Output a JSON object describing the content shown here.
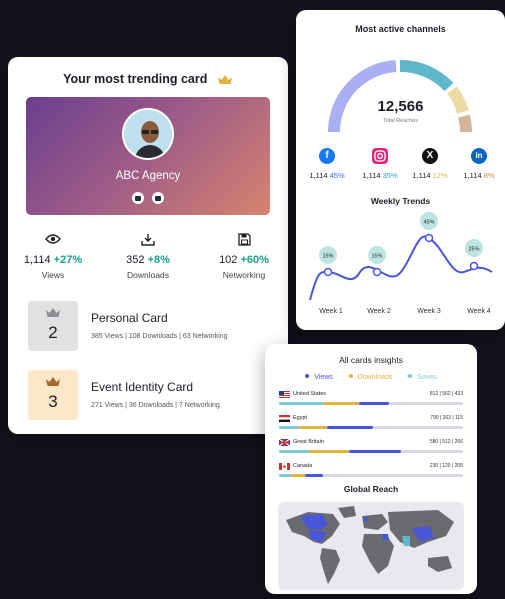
{
  "trending": {
    "title": "Your most trending card",
    "profile_name": "ABC Agency",
    "stats": [
      {
        "icon": "eye-icon",
        "value": "1,114",
        "delta": "+27%",
        "label": "Views"
      },
      {
        "icon": "download-icon",
        "value": "352",
        "delta": "+8%",
        "label": "Downloads"
      },
      {
        "icon": "save-icon",
        "value": "102",
        "delta": "+60%",
        "label": "Networking"
      }
    ],
    "ranks": [
      {
        "rank": "2",
        "title": "Personal Card",
        "sub": "385 Views  |  108 Downloads  |  63 Networking"
      },
      {
        "rank": "3",
        "title": "Event Identity Card",
        "sub": "271 Views  |  36 Downloads  |  7 Networking"
      }
    ]
  },
  "channels": {
    "title": "Most active channels",
    "total": "12,566",
    "total_label": "Total Reaches",
    "social": [
      {
        "icon": "facebook-icon",
        "count": "1,114",
        "pct": "45%",
        "color": "#1877f2",
        "pct_color": "#4e5ee0"
      },
      {
        "icon": "instagram-icon",
        "count": "1,114",
        "pct": "35%",
        "color": "#d62976",
        "pct_color": "#2b9fb3"
      },
      {
        "icon": "x-icon",
        "count": "1,114",
        "pct": "12%",
        "color": "#111111",
        "pct_color": "#d9b43a"
      },
      {
        "icon": "linkedin-icon",
        "count": "1,114",
        "pct": "8%",
        "color": "#0a66c2",
        "pct_color": "#c7875e"
      }
    ],
    "weekly_title": "Weekly Trends",
    "weeks": [
      "Week 1",
      "Week 2",
      "Week 3",
      "Week 4"
    ],
    "trend_labels": [
      "15%",
      "15%",
      "45%",
      "25%"
    ]
  },
  "insights": {
    "title": "All cards insights",
    "legend": [
      {
        "label": "Views",
        "color": "#4a56d8"
      },
      {
        "label": "Downloads",
        "color": "#e0b240"
      },
      {
        "label": "Saves",
        "color": "#7fc8d6"
      }
    ],
    "countries": [
      {
        "name": "United States",
        "values": "812 | 562 | 433"
      },
      {
        "name": "Egypt",
        "values": "790 | 263 | 115"
      },
      {
        "name": "Great Britain",
        "values": "580 | 512 | 266"
      },
      {
        "name": "Canada",
        "values": "230 | 120 | 205"
      }
    ],
    "reach_title": "Global Reach"
  },
  "colors": {
    "accent_teal": "#1a9e8a",
    "gauge_blue": "#a9aff0",
    "gauge_teal": "#5fb7cb",
    "gauge_yellow": "#ecdca4",
    "gauge_brown": "#d4b59a"
  }
}
